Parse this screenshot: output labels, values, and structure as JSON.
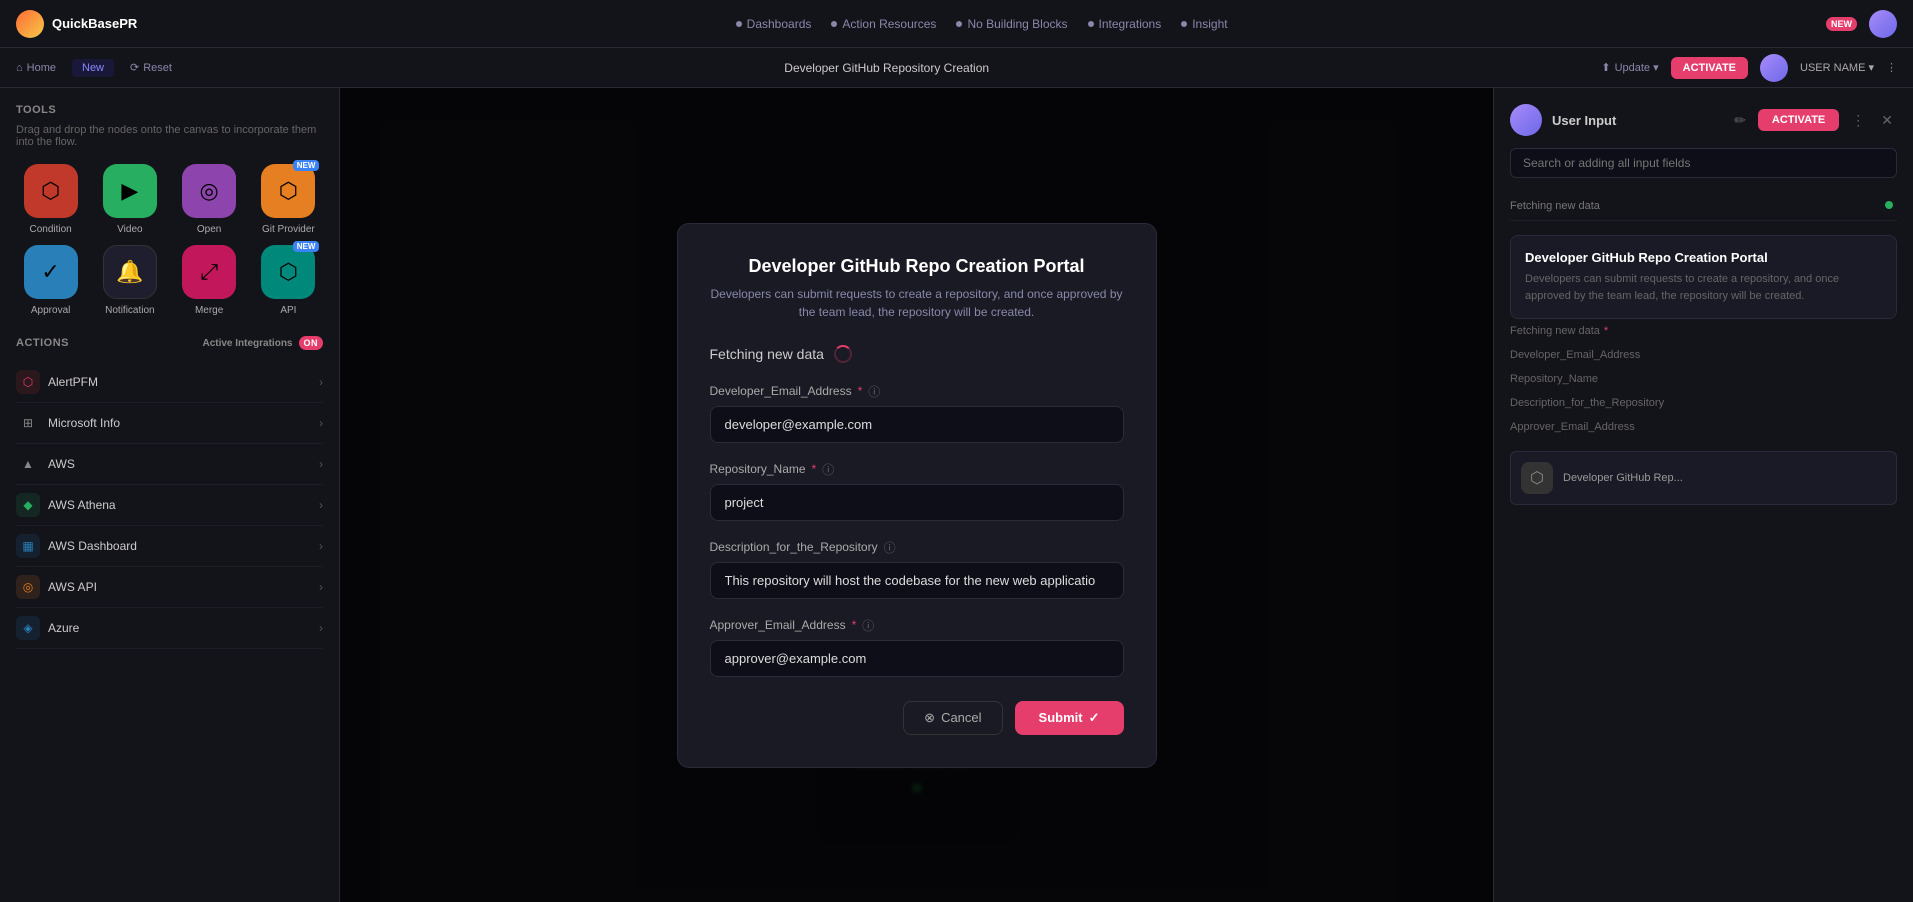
{
  "app": {
    "logo_text": "QuickBasePR",
    "nav_badge": "NEW"
  },
  "top_nav": {
    "items": [
      {
        "id": "dashboards",
        "label": "Dashboards"
      },
      {
        "id": "action-resources",
        "label": "Action Resources"
      },
      {
        "id": "no-building-blocks",
        "label": "No Building Blocks"
      },
      {
        "id": "integrations",
        "label": "Integrations"
      },
      {
        "id": "insight",
        "label": "Insight"
      }
    ]
  },
  "second_nav": {
    "left_items": [
      {
        "id": "home",
        "label": "Home"
      },
      {
        "id": "new",
        "label": "New"
      },
      {
        "id": "reset",
        "label": "Reset"
      }
    ],
    "center_title": "Developer GitHub Repository Creation",
    "right_items": [
      {
        "id": "updates",
        "label": "Update ▾"
      },
      {
        "id": "activate",
        "label": "ACTIVATE"
      }
    ]
  },
  "left_sidebar": {
    "tools_title": "Tools",
    "tools_desc": "Drag and drop the nodes onto the canvas to incorporate them into the flow.",
    "apps": [
      {
        "id": "condition",
        "label": "Condition",
        "color": "red",
        "icon": "⬡"
      },
      {
        "id": "video",
        "label": "Video",
        "color": "green",
        "icon": "▶"
      },
      {
        "id": "open",
        "label": "Open",
        "color": "purple",
        "icon": "◎"
      },
      {
        "id": "git-provider",
        "label": "Git Provider",
        "color": "orange",
        "icon": "⬡",
        "badge": "NEW"
      },
      {
        "id": "approval",
        "label": "Approval",
        "color": "blue",
        "icon": "✓"
      },
      {
        "id": "notification",
        "label": "Notification",
        "color": "dark",
        "icon": "🔔"
      },
      {
        "id": "merge",
        "label": "Merge",
        "color": "pink",
        "icon": "⤢"
      },
      {
        "id": "api",
        "label": "API",
        "color": "teal",
        "icon": "⬡",
        "badge": "NEW"
      }
    ],
    "actions_title": "Actions",
    "actions_badge": "Active Integrations",
    "actions_badge_count": "ON",
    "actions": [
      {
        "id": "alertpfm",
        "label": "AlertPFM",
        "dot_color": "red",
        "icon": "⬡"
      },
      {
        "id": "microsoft-info",
        "label": "Microsoft Info",
        "dot_color": "gray",
        "icon": "⊞"
      },
      {
        "id": "aws",
        "label": "AWS",
        "dot_color": "gray",
        "icon": "▲"
      },
      {
        "id": "aws-athena",
        "label": "AWS Athena",
        "dot_color": "green",
        "icon": "◆"
      },
      {
        "id": "aws-dashboard",
        "label": "AWS Dashboard",
        "dot_color": "blue",
        "icon": "▦"
      },
      {
        "id": "aws-api",
        "label": "AWS API",
        "dot_color": "orange",
        "icon": "◎"
      },
      {
        "id": "azure",
        "label": "Azure",
        "dot_color": "blue",
        "icon": "◈"
      }
    ]
  },
  "modal": {
    "title": "Developer GitHub Repo Creation Portal",
    "subtitle": "Developers can submit requests to create a repository, and once approved by the team lead, the repository will be created.",
    "fetching_label": "Fetching new data",
    "fields": [
      {
        "id": "developer-email",
        "label": "Developer_Email_Address",
        "required": true,
        "has_info": true,
        "value": "developer@example.com",
        "type": "email"
      },
      {
        "id": "repository-name",
        "label": "Repository_Name",
        "required": true,
        "has_info": true,
        "value": "project",
        "type": "text"
      },
      {
        "id": "description",
        "label": "Description_for_the_Repository",
        "required": false,
        "has_info": true,
        "value": "This repository will host the codebase for the new web applicatio",
        "type": "text"
      },
      {
        "id": "approver-email",
        "label": "Approver_Email_Address",
        "required": true,
        "has_info": true,
        "value": "approver@example.com",
        "type": "email"
      }
    ],
    "cancel_label": "Cancel",
    "submit_label": "Submit"
  },
  "right_sidebar": {
    "username": "User Input",
    "search_placeholder": "Search or adding all input fields",
    "activate_label": "ACTIVATE",
    "field_rows": [
      {
        "label": "Fetching new data",
        "value": "",
        "has_indicator": true
      },
      {
        "label": "Developer_Email_Address",
        "value": "",
        "required": true
      },
      {
        "label": "Repository_Name",
        "value": "",
        "required": true
      },
      {
        "label": "Description_for_the_Repository",
        "value": "",
        "required": true
      },
      {
        "label": "Approver_Email_Address",
        "value": "",
        "required": true
      }
    ],
    "card": {
      "title": "Developer GitHub Repo Creation Portal",
      "desc": "Developers can submit requests to create a repository, and once approved by the team lead, the repository will be created."
    }
  },
  "bottom_mini": {
    "label": "Developer GitHub Rep..."
  },
  "colors": {
    "accent": "#e53e6d",
    "bg_dark": "#0e0e12",
    "bg_card": "#1a1a24",
    "text_primary": "#ffffff",
    "text_secondary": "#8888aa"
  }
}
